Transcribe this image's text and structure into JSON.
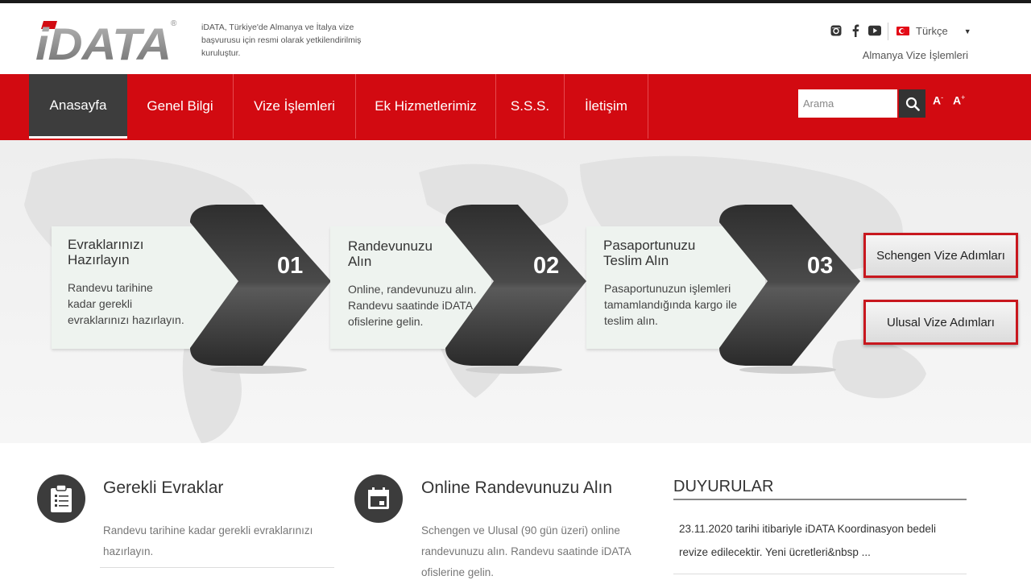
{
  "brand": {
    "logo_text": "iDATA",
    "registered": "®",
    "tagline": "iDATA, Türkiye'de Almanya ve İtalya vize başvurusu için resmi olarak yetkilendirilmiş kuruluştur."
  },
  "header": {
    "language": "Türkçe",
    "vize_link": "Almanya Vize İşlemleri"
  },
  "nav": {
    "items": [
      {
        "label": "Anasayfa",
        "active": true
      },
      {
        "label": "Genel Bilgi",
        "active": false
      },
      {
        "label": "Vize İşlemleri",
        "active": false
      },
      {
        "label": "Ek Hizmetlerimiz",
        "active": false
      },
      {
        "label": "S.S.S.",
        "active": false
      },
      {
        "label": "İletişim",
        "active": false
      }
    ],
    "search_placeholder": "Arama",
    "font_decrease": "A",
    "font_decrease_sup": "-",
    "font_increase": "A",
    "font_increase_sup": "+"
  },
  "hero": {
    "steps": [
      {
        "number": "01",
        "title_line1": "Evraklarınızı",
        "title_line2": "Hazırlayın",
        "desc_line1": "Randevu tarihine",
        "desc_line2": "kadar gerekli",
        "desc_line3": "evraklarınızı hazırlayın."
      },
      {
        "number": "02",
        "title_line1": "Randevunuzu",
        "title_line2": "Alın",
        "desc_line1": "Online, randevunuzu alın.",
        "desc_line2": "Randevu saatinde iDATA",
        "desc_line3": "ofislerine gelin."
      },
      {
        "number": "03",
        "title_line1": "Pasaportunuzu",
        "title_line2": "Teslim Alın",
        "desc_line1": "Pasaportunuzun işlemleri",
        "desc_line2": "tamamlandığında kargo ile",
        "desc_line3": "teslim alın."
      }
    ],
    "buttons": {
      "schengen": "Schengen Vize Adımları",
      "ulusal": "Ulusal Vize Adımları"
    }
  },
  "info": {
    "gerekli": {
      "title": "Gerekli Evraklar",
      "desc_line1": "Randevu tarihine kadar gerekli evraklarınızı",
      "desc_line2": "hazırlayın."
    },
    "online": {
      "title": "Online Randevunuzu Alın",
      "desc_line1": "Schengen ve Ulusal (90 gün üzeri) online",
      "desc_line2": "randevunuzu alın. Randevu saatinde iDATA",
      "desc_line3": "ofislerine gelin."
    },
    "duyurular": {
      "title": "DUYURULAR",
      "item_line1": "23.11.2020 tarihi itibariyle iDATA Koordinasyon bedeli",
      "item_line2": "revize edilecektir. Yeni ücretleri&nbsp ..."
    }
  },
  "colors": {
    "brand_red": "#d20a11",
    "nav_active": "#3d3d3d",
    "chevron_dark": "#3a3a3a"
  },
  "icons": [
    "instagram-icon",
    "facebook-icon",
    "youtube-icon",
    "turkey-flag-icon",
    "search-icon",
    "clipboard-icon",
    "calendar-icon"
  ]
}
